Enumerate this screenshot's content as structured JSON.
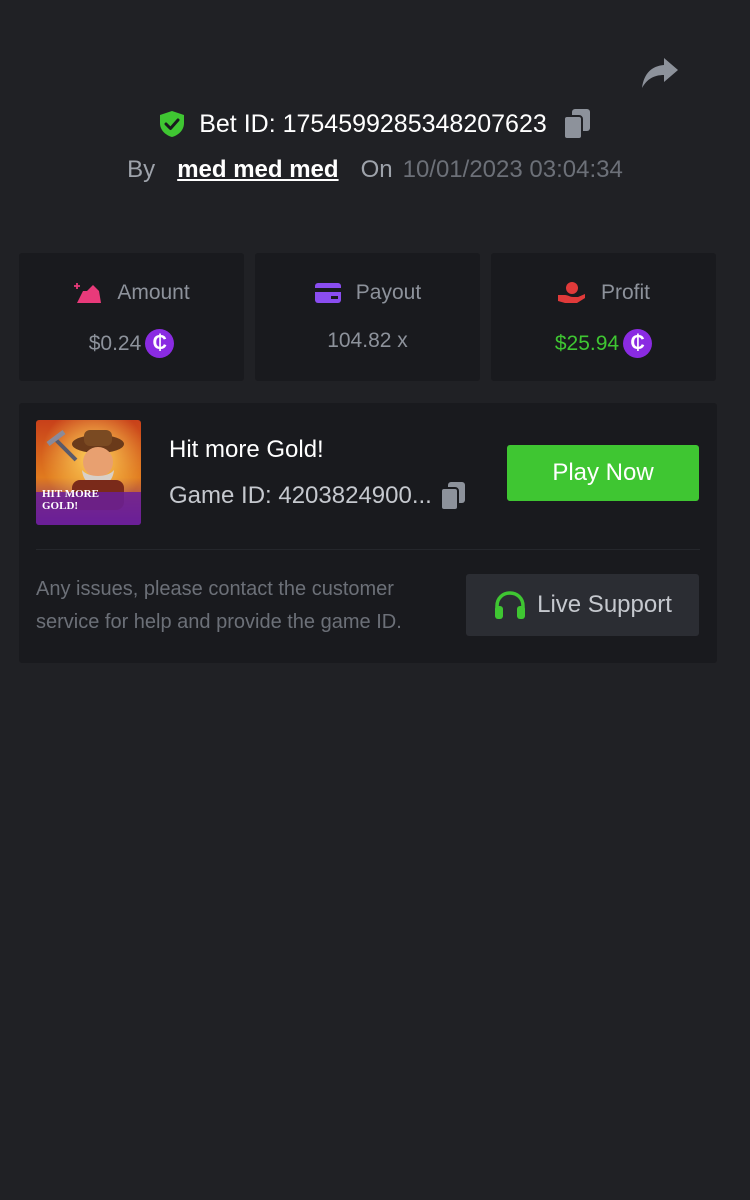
{
  "header": {
    "bet_label": "Bet ID: 1754599285348207623",
    "by_label": "By",
    "username": "med med med",
    "on_label": "On",
    "date": "10/01/2023 03:04:34"
  },
  "stats": [
    {
      "label": "Amount",
      "value": "$0.24",
      "icon": "amount-icon",
      "has_coin": true
    },
    {
      "label": "Payout",
      "value": "104.82 x",
      "icon": "card-icon",
      "has_coin": false
    },
    {
      "label": "Profit",
      "value": "$25.94",
      "icon": "profit-hand-icon",
      "has_coin": true
    }
  ],
  "coin_symbol": "₵",
  "game": {
    "thumb_text_line1": "HIT MORE",
    "thumb_text_line2": "GOLD!",
    "title": "Hit more Gold!",
    "game_id": "Game ID: 4203824900...",
    "play_label": "Play Now"
  },
  "support": {
    "text": "Any issues, please contact the customer service for help and provide the game ID.",
    "button_label": "Live Support"
  },
  "colors": {
    "background": "#202125",
    "card": "#191a1e",
    "accent_green": "#3fc632",
    "coin_purple": "#8a2be2",
    "amount_pink": "#e83a7a",
    "payout_purple": "#8a4df0",
    "profit_red": "#e03a3a"
  }
}
